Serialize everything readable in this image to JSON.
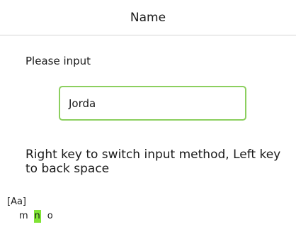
{
  "header": {
    "title": "Name"
  },
  "form": {
    "prompt": "Please input",
    "input_value": "Jorda"
  },
  "help": {
    "text": "Right key to switch input method, Left key to back space"
  },
  "input_method": {
    "mode_label": "[Aa]",
    "characters": [
      {
        "label": "m",
        "selected": false
      },
      {
        "label": "n",
        "selected": true
      },
      {
        "label": "o",
        "selected": false
      }
    ]
  },
  "colors": {
    "accent_border": "#8ccf5f",
    "selection_highlight": "#80e335"
  }
}
